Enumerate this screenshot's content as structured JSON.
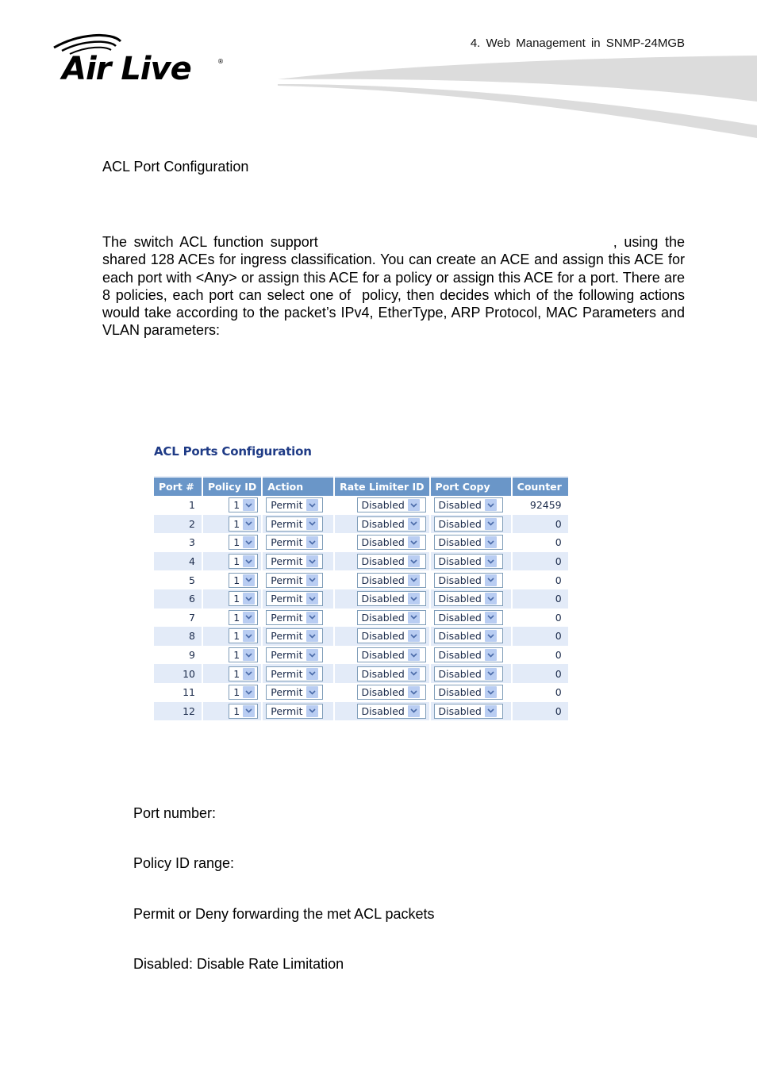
{
  "header": {
    "logo_text": "Air Live",
    "chapter": "4.   Web Management in SNMP-24MGB"
  },
  "section_title": "ACL Port Configuration",
  "intro": {
    "part1": "The switch ACL function support",
    "part2": ", using the shared 128 ACEs for ingress classification. You can create an ACE and assign this ACE for each port with <Any> or assign this ACE for a policy or assign this ACE for a port. There are 8 policies, each port can select one of",
    "part3": "policy, then decides which of the following actions would take according to the packet’s IPv4, EtherType, ARP Protocol, MAC Parameters and VLAN parameters:"
  },
  "panel": {
    "title": "ACL Ports Configuration",
    "columns": [
      "Port #",
      "Policy ID",
      "Action",
      "Rate Limiter ID",
      "Port Copy",
      "Counter"
    ],
    "rows": [
      {
        "port": "1",
        "policy": "1",
        "action": "Permit",
        "rate_limiter": "Disabled",
        "port_copy": "Disabled",
        "counter": "92459"
      },
      {
        "port": "2",
        "policy": "1",
        "action": "Permit",
        "rate_limiter": "Disabled",
        "port_copy": "Disabled",
        "counter": "0"
      },
      {
        "port": "3",
        "policy": "1",
        "action": "Permit",
        "rate_limiter": "Disabled",
        "port_copy": "Disabled",
        "counter": "0"
      },
      {
        "port": "4",
        "policy": "1",
        "action": "Permit",
        "rate_limiter": "Disabled",
        "port_copy": "Disabled",
        "counter": "0"
      },
      {
        "port": "5",
        "policy": "1",
        "action": "Permit",
        "rate_limiter": "Disabled",
        "port_copy": "Disabled",
        "counter": "0"
      },
      {
        "port": "6",
        "policy": "1",
        "action": "Permit",
        "rate_limiter": "Disabled",
        "port_copy": "Disabled",
        "counter": "0"
      },
      {
        "port": "7",
        "policy": "1",
        "action": "Permit",
        "rate_limiter": "Disabled",
        "port_copy": "Disabled",
        "counter": "0"
      },
      {
        "port": "8",
        "policy": "1",
        "action": "Permit",
        "rate_limiter": "Disabled",
        "port_copy": "Disabled",
        "counter": "0"
      },
      {
        "port": "9",
        "policy": "1",
        "action": "Permit",
        "rate_limiter": "Disabled",
        "port_copy": "Disabled",
        "counter": "0"
      },
      {
        "port": "10",
        "policy": "1",
        "action": "Permit",
        "rate_limiter": "Disabled",
        "port_copy": "Disabled",
        "counter": "0"
      },
      {
        "port": "11",
        "policy": "1",
        "action": "Permit",
        "rate_limiter": "Disabled",
        "port_copy": "Disabled",
        "counter": "0"
      },
      {
        "port": "12",
        "policy": "1",
        "action": "Permit",
        "rate_limiter": "Disabled",
        "port_copy": "Disabled",
        "counter": "0"
      }
    ]
  },
  "descriptions": [
    "Port number:",
    "Policy ID range:",
    "Permit or Deny forwarding the met ACL packets",
    "Disabled: Disable Rate Limitation"
  ],
  "colors": {
    "header_bg": "#6a96c8",
    "even_row_bg": "#e3ebf8",
    "panel_title": "#1f3b86",
    "swoosh": "#dcdcdc"
  }
}
